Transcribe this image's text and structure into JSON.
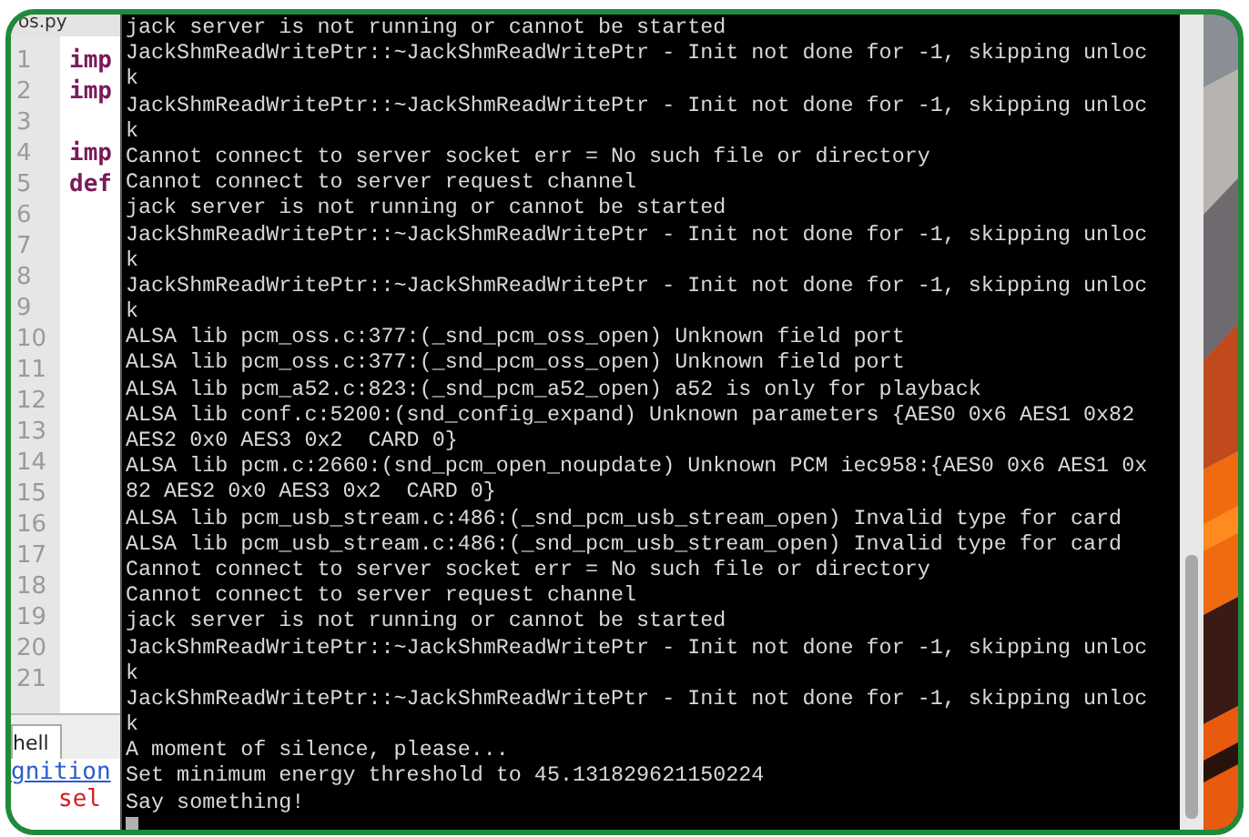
{
  "editor": {
    "file_tab": "os.py",
    "lines": [
      {
        "number": "1",
        "code": "imp"
      },
      {
        "number": "2",
        "code": "imp"
      },
      {
        "number": "3"
      },
      {
        "number": "4",
        "code": "imp"
      },
      {
        "number": "5",
        "code": "def"
      },
      {
        "number": "6"
      },
      {
        "number": "7"
      },
      {
        "number": "8"
      },
      {
        "number": "9"
      },
      {
        "number": "10"
      },
      {
        "number": "11"
      },
      {
        "number": "12"
      },
      {
        "number": "13"
      },
      {
        "number": "14"
      },
      {
        "number": "15"
      },
      {
        "number": "16"
      },
      {
        "number": "17"
      },
      {
        "number": "18"
      },
      {
        "number": "19"
      },
      {
        "number": "20"
      },
      {
        "number": "21"
      }
    ],
    "shell_tab": "hell",
    "shell_lines": [
      {
        "kind": "link",
        "text": "gnition"
      },
      {
        "kind": "error",
        "text": "sel"
      }
    ]
  },
  "terminal": {
    "lines": [
      "jack server is not running or cannot be started",
      "JackShmReadWritePtr::~JackShmReadWritePtr - Init not done for -1, skipping unloc",
      "k",
      "JackShmReadWritePtr::~JackShmReadWritePtr - Init not done for -1, skipping unloc",
      "k",
      "Cannot connect to server socket err = No such file or directory",
      "Cannot connect to server request channel",
      "jack server is not running or cannot be started",
      "JackShmReadWritePtr::~JackShmReadWritePtr - Init not done for -1, skipping unloc",
      "k",
      "JackShmReadWritePtr::~JackShmReadWritePtr - Init not done for -1, skipping unloc",
      "k",
      "ALSA lib pcm_oss.c:377:(_snd_pcm_oss_open) Unknown field port",
      "ALSA lib pcm_oss.c:377:(_snd_pcm_oss_open) Unknown field port",
      "ALSA lib pcm_a52.c:823:(_snd_pcm_a52_open) a52 is only for playback",
      "ALSA lib conf.c:5200:(snd_config_expand) Unknown parameters {AES0 0x6 AES1 0x82",
      "AES2 0x0 AES3 0x2  CARD 0}",
      "ALSA lib pcm.c:2660:(snd_pcm_open_noupdate) Unknown PCM iec958:{AES0 0x6 AES1 0x",
      "82 AES2 0x0 AES3 0x2  CARD 0}",
      "ALSA lib pcm_usb_stream.c:486:(_snd_pcm_usb_stream_open) Invalid type for card",
      "ALSA lib pcm_usb_stream.c:486:(_snd_pcm_usb_stream_open) Invalid type for card",
      "Cannot connect to server socket err = No such file or directory",
      "Cannot connect to server request channel",
      "jack server is not running or cannot be started",
      "JackShmReadWritePtr::~JackShmReadWritePtr - Init not done for -1, skipping unloc",
      "k",
      "JackShmReadWritePtr::~JackShmReadWritePtr - Init not done for -1, skipping unloc",
      "k",
      "A moment of silence, please...",
      "Set minimum energy threshold to 45.131829621150224",
      "Say something!"
    ]
  }
}
